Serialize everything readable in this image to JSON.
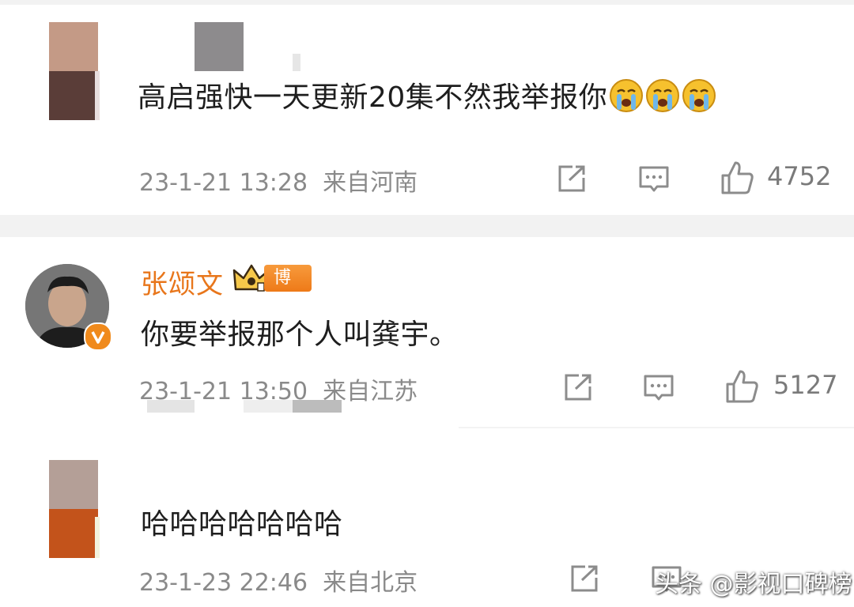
{
  "comments": [
    {
      "text": "高启强快一天更新20集不然我举报你",
      "emojis": [
        "crying-emoji",
        "crying-emoji",
        "crying-emoji"
      ],
      "timestamp": "23-1-21 13:28",
      "location": "来自河南",
      "likes": "4752"
    },
    {
      "username": "张颂文",
      "badge": "博主",
      "text": "你要举报那个人叫龚宇。",
      "timestamp": "23-1-21 13:50",
      "location": "来自江苏",
      "likes": "5127"
    },
    {
      "text": "哈哈哈哈哈哈哈",
      "timestamp": "23-1-23 22:46",
      "location": "来自北京"
    }
  ],
  "watermark": "头条 @影视口碑榜",
  "colors": {
    "username": "#e8761b",
    "meta": "#8a8a8a",
    "separator": "#f2f2f2",
    "verified": "#f08a1c"
  },
  "icons": [
    "share-icon",
    "comment-icon",
    "like-icon",
    "crown-icon",
    "verified-v-icon"
  ]
}
